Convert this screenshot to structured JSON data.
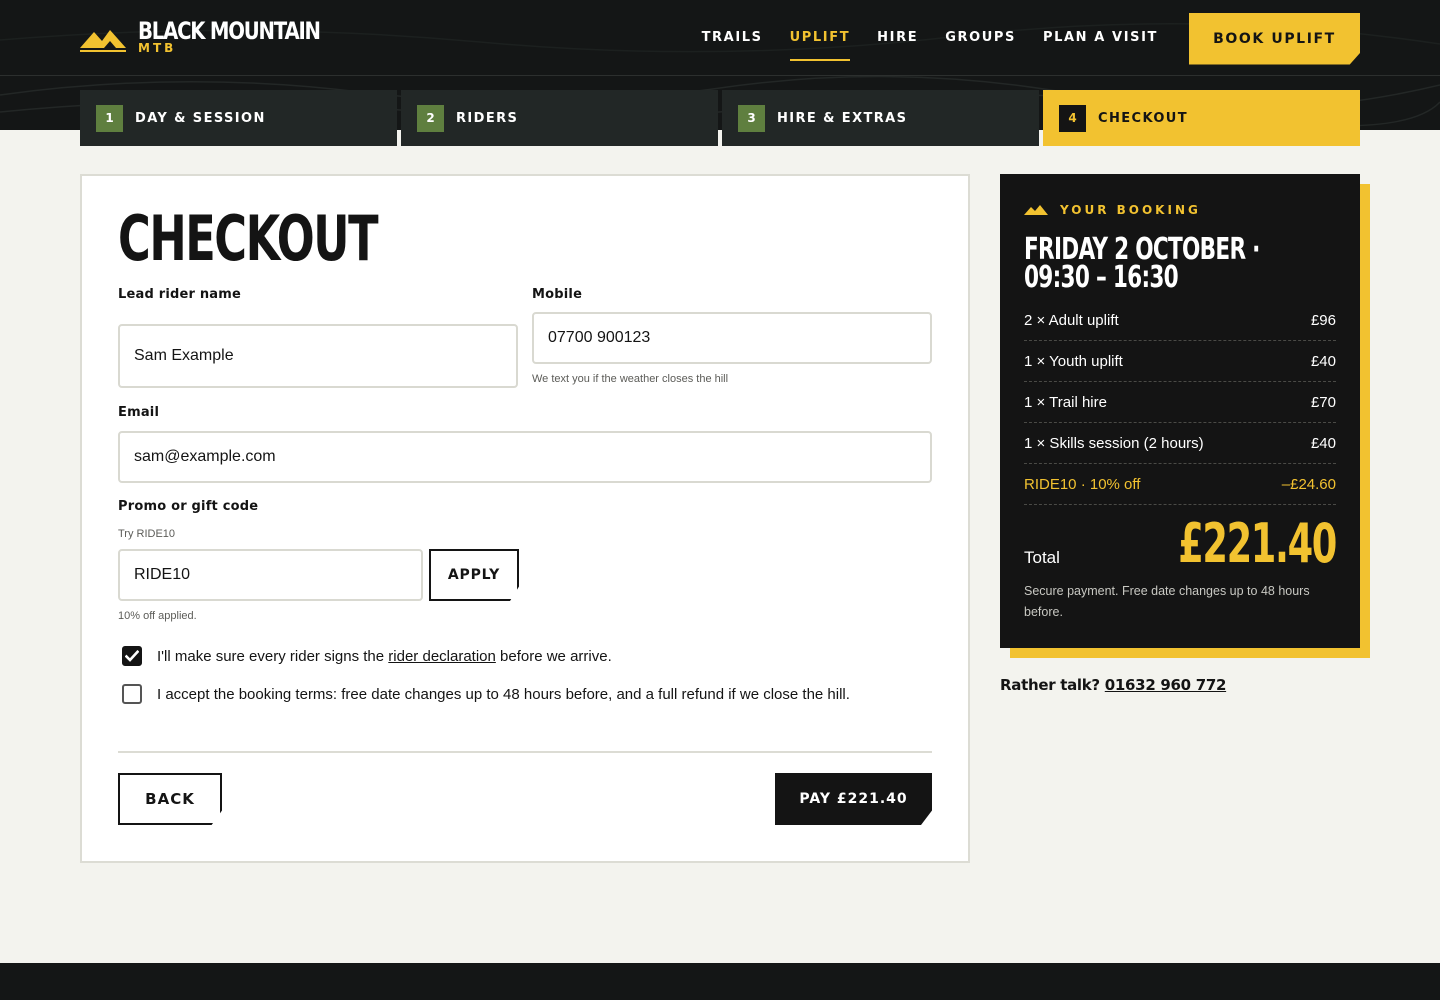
{
  "header": {
    "brand_title": "BLACK MOUNTAIN",
    "brand_sub": "MTB",
    "nav": [
      {
        "label": "TRAILS",
        "active": false
      },
      {
        "label": "UPLIFT",
        "active": true
      },
      {
        "label": "HIRE",
        "active": false
      },
      {
        "label": "GROUPS",
        "active": false
      },
      {
        "label": "PLAN A VISIT",
        "active": false
      }
    ],
    "cta_label": "BOOK UPLIFT"
  },
  "steps": [
    {
      "num": "1",
      "label": "DAY & SESSION"
    },
    {
      "num": "2",
      "label": "RIDERS"
    },
    {
      "num": "3",
      "label": "HIRE & EXTRAS"
    },
    {
      "num": "4",
      "label": "CHECKOUT"
    }
  ],
  "form": {
    "title": "CHECKOUT",
    "lead_label": "Lead rider name",
    "lead_value": "Sam Example",
    "mobile_label": "Mobile",
    "mobile_value": "07700 900123",
    "mobile_hint": "We text you if the weather closes the hill",
    "email_label": "Email",
    "email_value": "sam@example.com",
    "promo_label": "Promo or gift code",
    "promo_hint": "Try RIDE10",
    "promo_value": "RIDE10",
    "apply_label": "APPLY",
    "promo_status": "10% off applied.",
    "declaration_pre": "I'll make sure every rider signs the ",
    "declaration_link": "rider declaration",
    "declaration_post": " before we arrive.",
    "declaration_checked": true,
    "terms_text": "I accept the booking terms: free date changes up to 48 hours before, and a full refund if we close the hill.",
    "terms_checked": false,
    "back_label": "BACK",
    "pay_label": "PAY £221.40"
  },
  "summary": {
    "kicker": "YOUR BOOKING",
    "title": "FRIDAY 2 OCTOBER · 09:30 – 16:30",
    "lines": [
      {
        "label": "2 × Adult uplift",
        "amount": "£96"
      },
      {
        "label": "1 × Youth uplift",
        "amount": "£40"
      },
      {
        "label": "1 × Trail hire",
        "amount": "£70"
      },
      {
        "label": "1 × Skills session (2 hours)",
        "amount": "£40"
      }
    ],
    "promo_line": {
      "label": "RIDE10 · 10% off",
      "amount": "–£24.60"
    },
    "total_label": "Total",
    "total_value": "£221.40",
    "note": "Secure payment. Free date changes up to 48 hours before."
  },
  "contact": {
    "prefix": "Rather talk?",
    "phone": "01632 960 772"
  },
  "colors": {
    "accent": "#f2c230",
    "dark": "#141414",
    "step_badge": "#5f7f3f"
  }
}
